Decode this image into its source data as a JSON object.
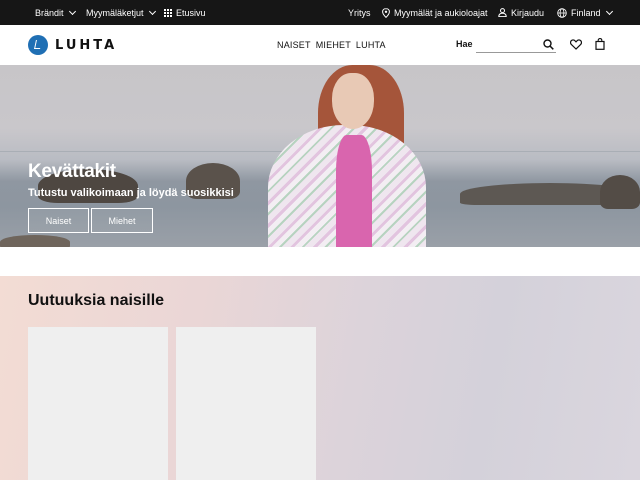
{
  "topbar": {
    "brands_label": "Brändit",
    "stores_label": "Myymäläketjut",
    "home_label": "Etusivu",
    "company_label": "Yritys",
    "locations_label": "Myymälät ja aukioloajat",
    "login_label": "Kirjaudu",
    "country_label": "Finland"
  },
  "header": {
    "logo_text": "LUHTA",
    "nav": [
      "NAISET",
      "MIEHET",
      "LUHTA"
    ],
    "search_label": "Hae",
    "search_placeholder": ""
  },
  "hero": {
    "title": "Kevättakit",
    "subtitle": "Tutustu valikoimaan ja löydä suosikkisi",
    "buttons": [
      "Naiset",
      "Miehet"
    ]
  },
  "section": {
    "title": "Uutuuksia naisille"
  },
  "colors": {
    "topbar_bg": "#161616",
    "logo_blue": "#1f6fb4"
  }
}
